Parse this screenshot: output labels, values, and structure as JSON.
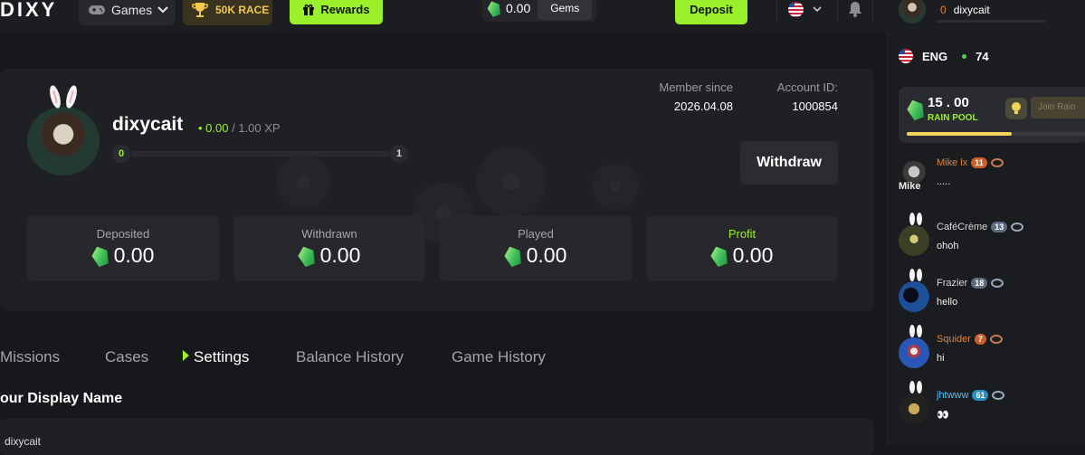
{
  "header": {
    "logo": "DIXY",
    "games_label": "Games",
    "race_label": "50K RACE",
    "rewards_label": "Rewards",
    "gems_amount": "0.00",
    "gems_label": "Gems",
    "deposit_label": "Deposit",
    "user_level": "0",
    "username": "dixycait"
  },
  "profile": {
    "username": "dixycait",
    "xp_current": "0.00",
    "xp_max": "/ 1.00 XP",
    "level_start": "0",
    "level_end": "1",
    "member_since_label": "Member since",
    "member_since_value": "2026.04.08",
    "account_id_label": "Account ID:",
    "account_id_value": "1000854",
    "withdraw_label": "Withdraw",
    "stats": [
      {
        "label": "Deposited",
        "value": "0.00"
      },
      {
        "label": "Withdrawn",
        "value": "0.00"
      },
      {
        "label": "Played",
        "value": "0.00"
      },
      {
        "label": "Profit",
        "value": "0.00"
      }
    ]
  },
  "tabs": [
    "Missions",
    "Cases",
    "Settings",
    "Balance History",
    "Game History"
  ],
  "active_tab": "Settings",
  "settings": {
    "display_name_title": "our Display Name",
    "display_name_value": "dixycait"
  },
  "chat": {
    "language": "ENG",
    "online_count": "74",
    "rain": {
      "amount": "15 . 00",
      "label": "RAIN POOL",
      "button": "Join Rain",
      "progress": 0.58
    },
    "messages": [
      {
        "name": "Mike lx",
        "level": "11",
        "text": ".....",
        "name_color": "#e0823d",
        "avatar_caption": "Mike"
      },
      {
        "name": "CaféCrème",
        "level": "13",
        "text": "ohoh",
        "name_color": "#d8d8d8"
      },
      {
        "name": "Frazier",
        "level": "18",
        "text": "hello",
        "name_color": "#d8d8d8"
      },
      {
        "name": "Squider",
        "level": "7",
        "text": "hi",
        "name_color": "#e0823d"
      },
      {
        "name": "jhtwww",
        "level": "61",
        "text": "👀",
        "name_color": "#4fc3f7"
      }
    ]
  },
  "colors": {
    "accent": "#9af02a",
    "background": "#17181c",
    "card": "#1f2024"
  }
}
